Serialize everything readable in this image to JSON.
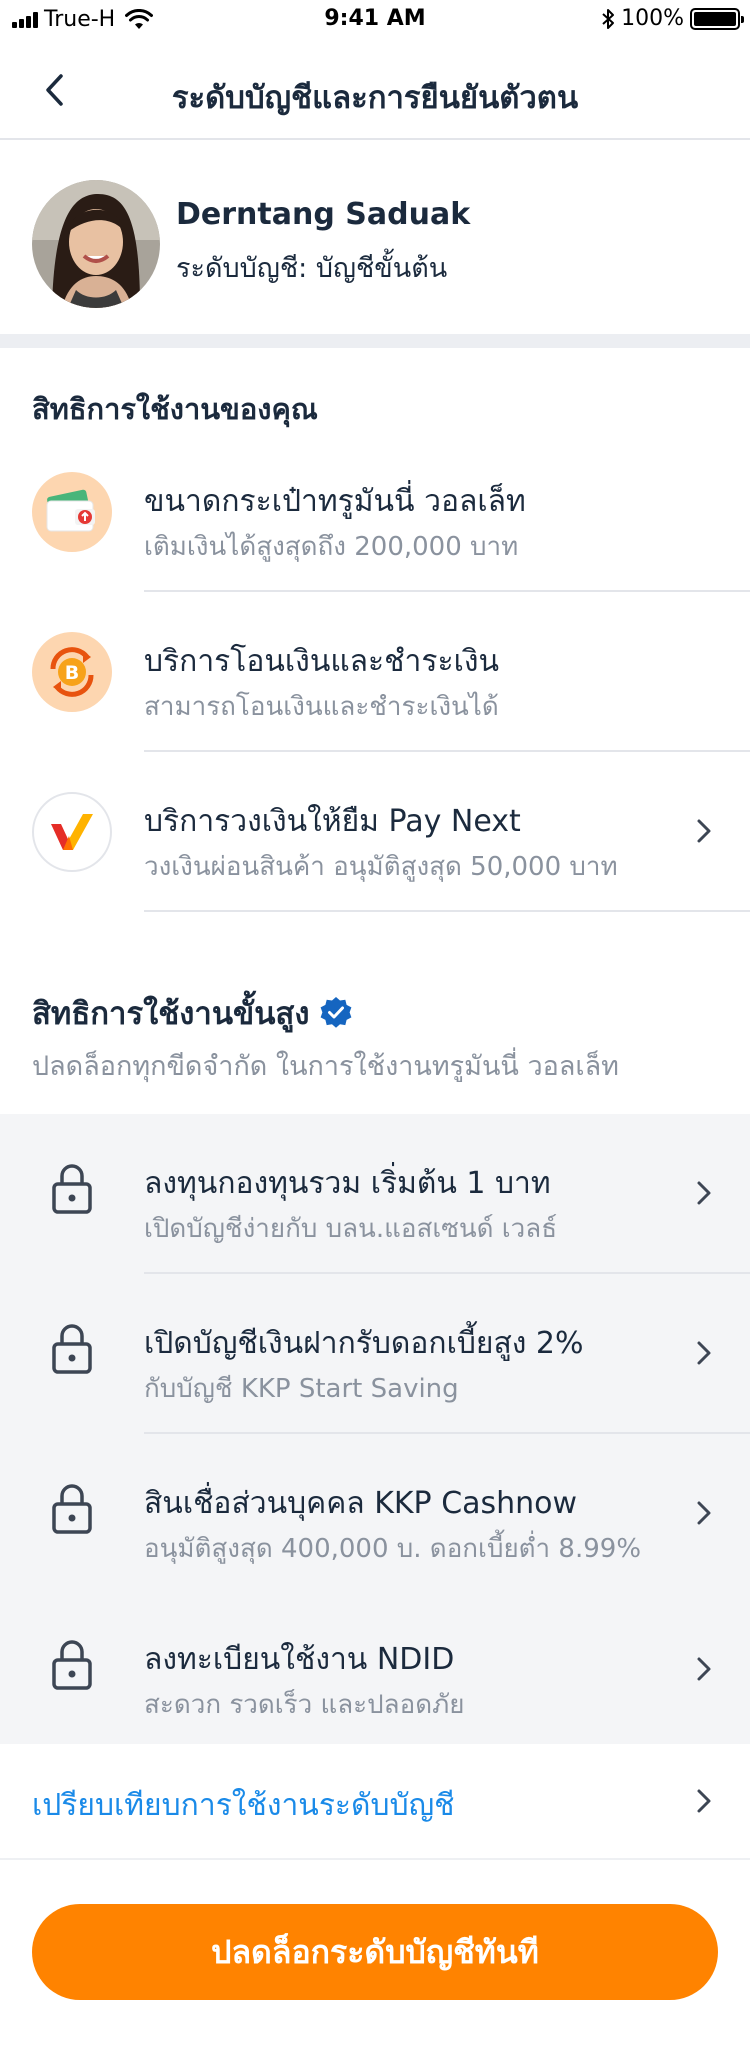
{
  "status_bar": {
    "carrier": "True-H",
    "time": "9:41 AM",
    "battery": "100%"
  },
  "nav": {
    "title": "ระดับบัญชีและการยืนยันตัวตน"
  },
  "profile": {
    "name": "Derntang Saduak",
    "level": "ระดับบัญชี: บัญชีขั้นต้น"
  },
  "your_rights": {
    "title": "สิทธิการใช้งานของคุณ",
    "items": [
      {
        "title": "ขนาดกระเป๋าทรูมันนี่ วอลเล็ท",
        "subtitle": "เติมเงินได้สูงสุดถึง 200,000 บาท",
        "icon": "wallet-icon"
      },
      {
        "title": "บริการโอนเงินและชำระเงิน",
        "subtitle": "สามารถโอนเงินและชำระเงินได้",
        "icon": "transfer-coin-icon"
      },
      {
        "title": "บริการวงเงินให้ยืม Pay Next",
        "subtitle": "วงเงินผ่อนสินค้า อนุมัติสูงสุด 50,000 บาท",
        "icon": "pay-next-logo-icon"
      }
    ]
  },
  "advanced_rights": {
    "title": "สิทธิการใช้งานขั้นสูง",
    "subtitle": "ปลดล็อกทุกขีดจำกัด ในการใช้งานทรูมันนี่ วอลเล็ท",
    "items": [
      {
        "title": "ลงทุนกองทุนรวม เริ่มต้น 1 บาท",
        "subtitle": "เปิดบัญชีง่ายกับ บลน.แอสเซนด์ เวลธ์"
      },
      {
        "title": "เปิดบัญชีเงินฝากรับดอกเบี้ยสูง 2%",
        "subtitle": "กับบัญชี KKP Start Saving"
      },
      {
        "title": "สินเชื่อส่วนบุคคล KKP Cashnow",
        "subtitle": "อนุมัติสูงสุด 400,000 บ. ดอกเบี้ยต่ำ 8.99%"
      },
      {
        "title": "ลงทะเบียนใช้งาน NDID",
        "subtitle": "สะดวก รวดเร็ว และปลอดภัย"
      }
    ]
  },
  "compare": {
    "label": "เปรียบเทียบการใช้งานระดับบัญชี"
  },
  "cta": {
    "label": "ปลดล็อกระดับบัญชีทันที"
  },
  "colors": {
    "accent_orange": "#ff8300",
    "link_blue": "#1a8ae8",
    "verified_blue": "#1565c0",
    "text_dark": "#1b2a3d",
    "text_grey": "#8a929e"
  }
}
